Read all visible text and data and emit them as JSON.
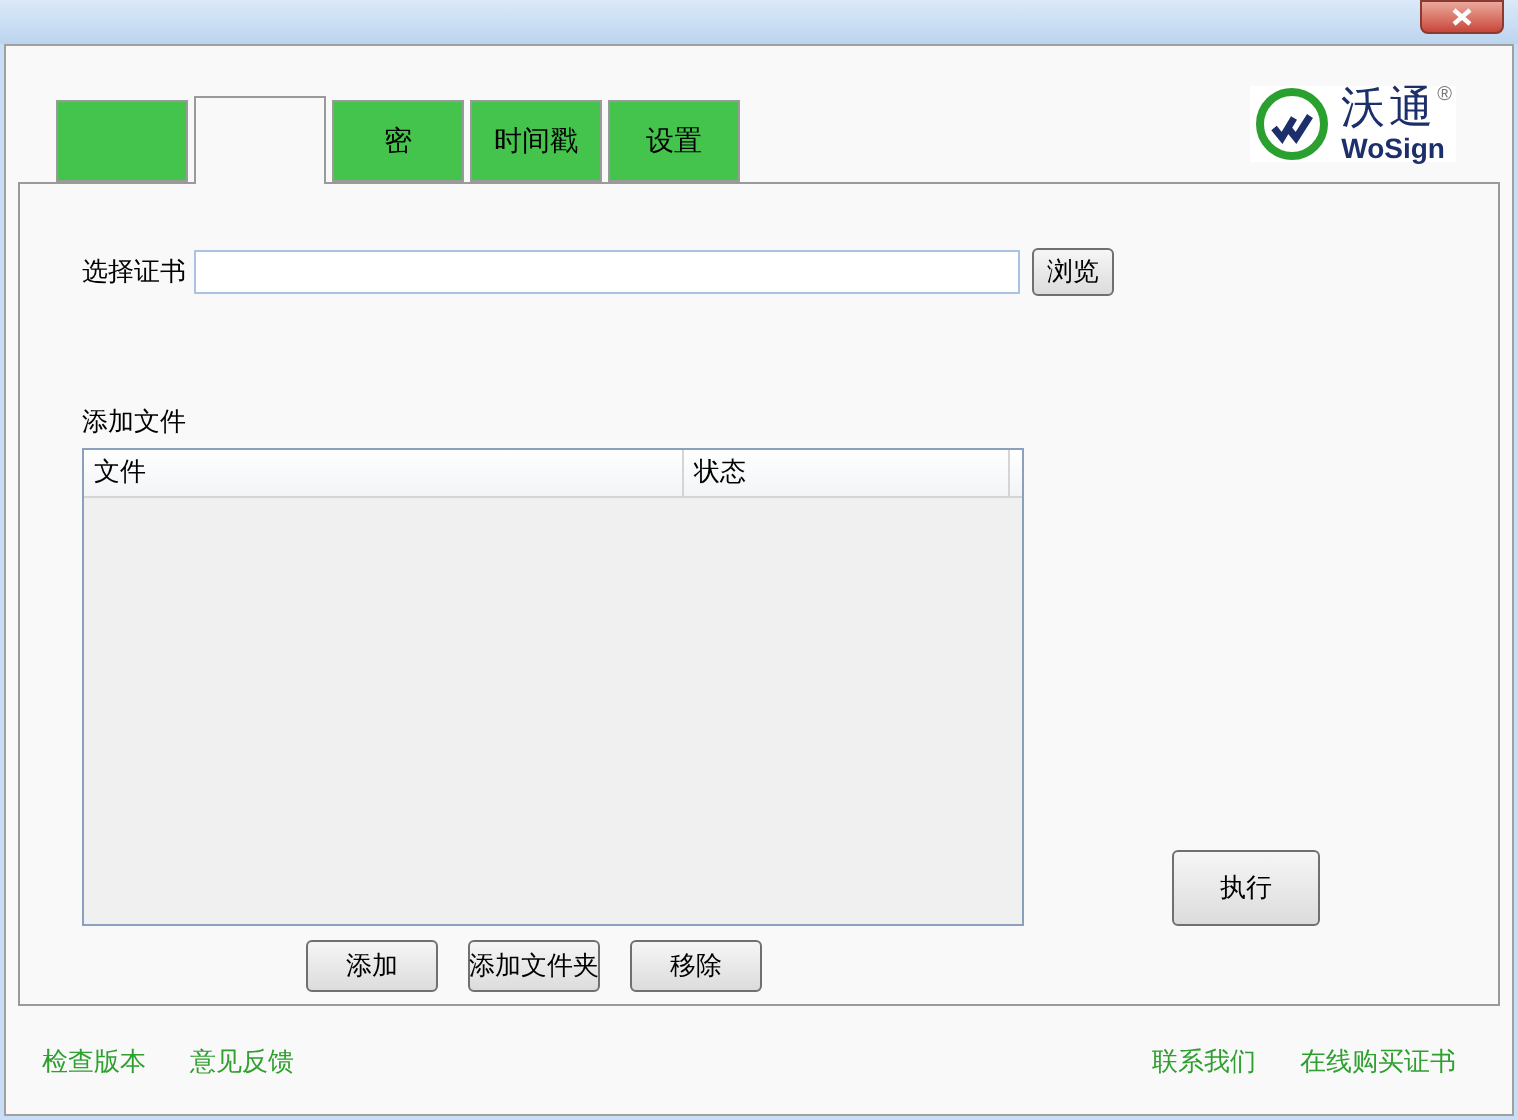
{
  "tabs": [
    {
      "selected": false
    },
    {
      "selected": true
    },
    {
      "label": "密",
      "selected": false
    },
    {
      "label": "时间戳",
      "selected": false
    },
    {
      "label": "设置",
      "selected": false
    }
  ],
  "logo": {
    "name": "沃通",
    "registered": "®",
    "brand": "WoSign"
  },
  "certificate": {
    "label": "选择证书",
    "browse": "浏览"
  },
  "files": {
    "label": "添加文件",
    "columns": [
      "文件",
      "状态"
    ],
    "buttons": [
      "添加",
      "添加文件夹",
      "移除"
    ]
  },
  "execute": "执行",
  "footer": {
    "left_links": [
      "检查版本",
      "意见反馈"
    ],
    "right_links": [
      "联系我们",
      "在线购买证书"
    ]
  }
}
